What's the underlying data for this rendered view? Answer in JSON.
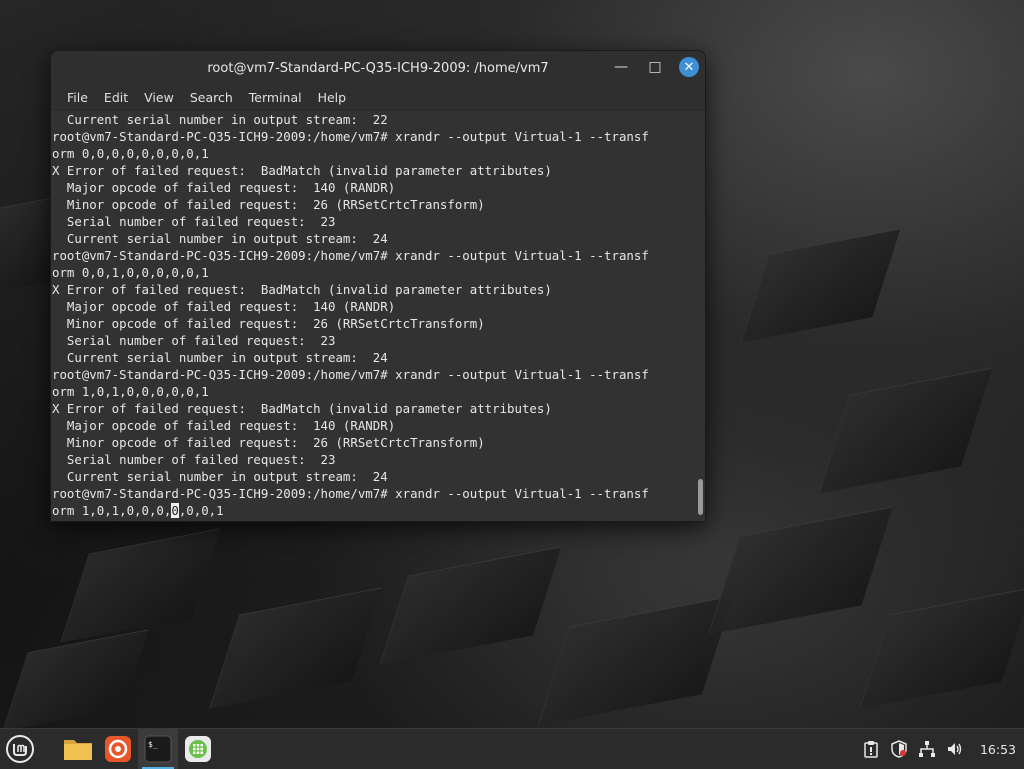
{
  "window": {
    "title": "root@vm7-Standard-PC-Q35-ICH9-2009: /home/vm7",
    "minimize_icon": "minimize-icon",
    "maximize_icon": "maximize-icon",
    "close_icon": "close-icon"
  },
  "menu": [
    "File",
    "Edit",
    "View",
    "Search",
    "Terminal",
    "Help"
  ],
  "terminal": {
    "lines_before_cursor": "  Current serial number in output stream:  22\nroot@vm7-Standard-PC-Q35-ICH9-2009:/home/vm7# xrandr --output Virtual-1 --transf\norm 0,0,0,0,0,0,0,0,1\nX Error of failed request:  BadMatch (invalid parameter attributes)\n  Major opcode of failed request:  140 (RANDR)\n  Minor opcode of failed request:  26 (RRSetCrtcTransform)\n  Serial number of failed request:  23\n  Current serial number in output stream:  24\nroot@vm7-Standard-PC-Q35-ICH9-2009:/home/vm7# xrandr --output Virtual-1 --transf\norm 0,0,1,0,0,0,0,0,1\nX Error of failed request:  BadMatch (invalid parameter attributes)\n  Major opcode of failed request:  140 (RANDR)\n  Minor opcode of failed request:  26 (RRSetCrtcTransform)\n  Serial number of failed request:  23\n  Current serial number in output stream:  24\nroot@vm7-Standard-PC-Q35-ICH9-2009:/home/vm7# xrandr --output Virtual-1 --transf\norm 1,0,1,0,0,0,0,0,1\nX Error of failed request:  BadMatch (invalid parameter attributes)\n  Major opcode of failed request:  140 (RANDR)\n  Minor opcode of failed request:  26 (RRSetCrtcTransform)\n  Serial number of failed request:  23\n  Current serial number in output stream:  24\nroot@vm7-Standard-PC-Q35-ICH9-2009:/home/vm7# xrandr --output Virtual-1 --transf\norm 1,0,1,0,0,0,",
    "cursor_char": "0",
    "after_cursor": ",0,0,1"
  },
  "taskbar": {
    "apps": [
      {
        "name": "mint-menu",
        "icon": "mint-logo-icon"
      },
      {
        "name": "files",
        "icon": "folder-icon"
      },
      {
        "name": "firefox",
        "icon": "firefox-icon"
      },
      {
        "name": "terminal",
        "icon": "terminal-icon",
        "active": true
      },
      {
        "name": "app-grid",
        "icon": "grid-app-icon"
      }
    ],
    "tray_icons": [
      "clipboard-icon",
      "shield-icon",
      "network-icon",
      "volume-icon"
    ],
    "clock": "16:53"
  },
  "colors": {
    "accent": "#57b1e6",
    "close_button": "#3d8fd6",
    "terminal_bg": "#323232",
    "mint_green": "#8bc34a"
  }
}
